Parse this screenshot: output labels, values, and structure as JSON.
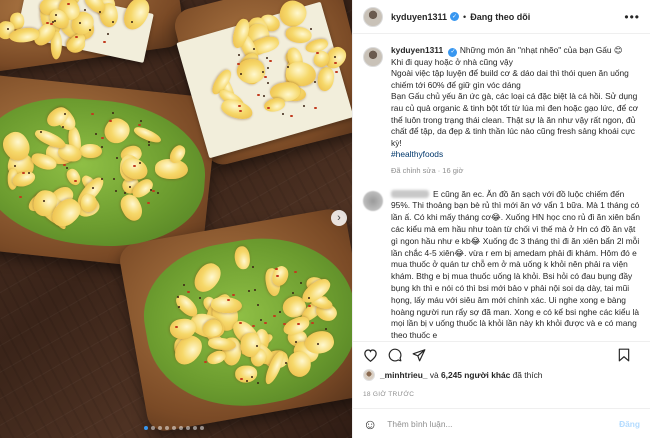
{
  "header": {
    "username": "kyduyen1311",
    "separator": "•",
    "follow_status": "Đang theo dõi",
    "more_glyph": "•••"
  },
  "caption": {
    "username": "kyduyen1311",
    "line1": "Những món ăn \"nhạt nhẽo\" của bạn Gấu 😊",
    "line2": "Khi đi quay hoặc ở nhà cũng vậy",
    "para1": "Ngoài việc tập luyện để build cơ & dáo dai thì thói quen ăn uống chiếm tới 60% để giữ gìn vóc dáng",
    "para2": "Bạn Gấu chủ yếu ăn ức gà, các loại cá đặc biệt là cá hồi. Sử dụng rau củ quả organic & tinh bột tốt từ lúa mì đen hoặc gạo lức, để cơ thể luôn trong trạng thái clean. Thật sự là ăn như vậy rất ngon, đủ chất để tập, da đẹp & tinh thần lúc nào cũng fresh sảng khoái cực kỳ!",
    "hashtag": "#healthyfoods",
    "meta": "Đã chỉnh sửa · 16 giờ"
  },
  "comment": {
    "text": "E cũng ăn ec. Ăn đồ ăn sạch với đồ luộc chiếm đến 95%. Thi thoảng bạn bè rủ thì mới ăn vớ vẩn 1 bữa. Mà 1 tháng có lần ấ. Có khi mấy tháng cơ😂. Xuống HN học cno rủ đi ăn xiên bẩn các kiểu mà em hầu như toàn từ chối vì thế mà ở Hn có đồ ăn vặt gì ngon hầu như e kb😂 Xuống đc 3 tháng thì đi ăn xiên bẩn 2l mỗi lần chắc 4-5 xiên😂. vừa r em bị amedam phải đi khám. Hôm đó e mua thuốc ở quán tư chỗ em ở mà uống k khỏi nên phải ra viện khám. Bthg e bị mua thuốc uống là khỏi. Bsi hỏi có đau bụng đầy bụng kh thì e nói có thì bsi mới bảo v phải nội soi dạ dày, tai mũi họng, lấy máu với siêu âm mới chính xác. Ui nghe xong e bàng hoàng người run rẩy sợ đã man. Xong e có kể bsi nghe các kiểu là mọi lần bị v uống thuốc là khỏi lần này kh khỏi được và e có mang theo thuốc e"
  },
  "likes": {
    "liker": "_minhtrieu_",
    "and_text": "và",
    "others": "6,245 người khác",
    "liked_text": "đã thích"
  },
  "timestamp": "18 GIỜ TRƯỚC",
  "add_comment": {
    "placeholder": "Thêm bình luận...",
    "post": "Đăng",
    "emoji": "☺"
  },
  "photo": {
    "next_glyph": "›",
    "slide_count": 9,
    "active_slide": 1
  },
  "colors": {
    "verified": "#3897f0",
    "link": "#00376b",
    "muted": "#8e8e8e",
    "post_disabled": "#b3dbff"
  }
}
